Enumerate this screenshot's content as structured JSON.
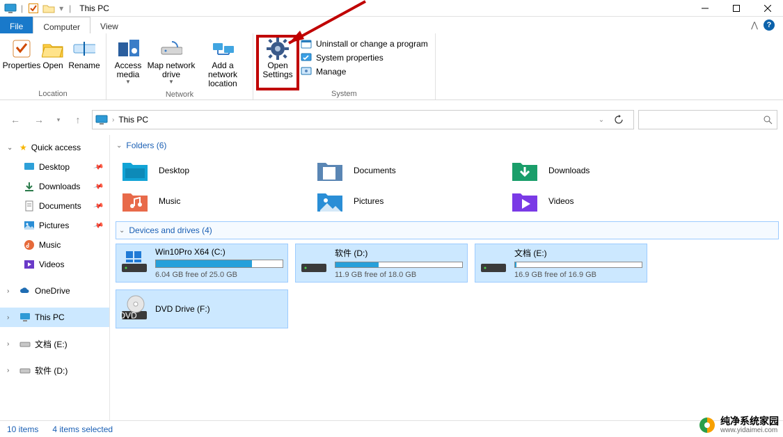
{
  "titlebar": {
    "title": "This PC"
  },
  "tabs": {
    "file": "File",
    "computer": "Computer",
    "view": "View"
  },
  "ribbon": {
    "location": {
      "properties": "Properties",
      "open": "Open",
      "rename": "Rename",
      "group": "Location"
    },
    "network": {
      "access_media": "Access media",
      "map_drive": "Map network drive",
      "add_location": "Add a network location",
      "group": "Network"
    },
    "system": {
      "open_settings_l1": "Open",
      "open_settings_l2": "Settings",
      "uninstall": "Uninstall or change a program",
      "sysprops": "System properties",
      "manage": "Manage",
      "group": "System"
    }
  },
  "address": {
    "crumb": "This PC"
  },
  "nav": {
    "quick_access": "Quick access",
    "desktop": "Desktop",
    "downloads": "Downloads",
    "documents": "Documents",
    "pictures": "Pictures",
    "music": "Music",
    "videos": "Videos",
    "onedrive": "OneDrive",
    "this_pc": "This PC",
    "doc_e": "文档 (E:)",
    "soft_d": "软件 (D:)"
  },
  "content": {
    "folders_header": "Folders (6)",
    "drives_header": "Devices and drives (4)",
    "folders": {
      "desktop": "Desktop",
      "documents": "Documents",
      "downloads": "Downloads",
      "music": "Music",
      "pictures": "Pictures",
      "videos": "Videos"
    },
    "drives": [
      {
        "name": "Win10Pro X64 (C:)",
        "free": "6.04 GB free of 25.0 GB",
        "fill_pct": 76
      },
      {
        "name": "软件 (D:)",
        "free": "11.9 GB free of 18.0 GB",
        "fill_pct": 34
      },
      {
        "name": "文档 (E:)",
        "free": "16.9 GB free of 16.9 GB",
        "fill_pct": 1
      },
      {
        "name": "DVD Drive (F:)",
        "free": "",
        "fill_pct": null
      }
    ]
  },
  "status": {
    "items": "10 items",
    "selected": "4 items selected"
  },
  "watermark": {
    "name": "纯净系统家园",
    "url": "www.yidaimei.com"
  }
}
